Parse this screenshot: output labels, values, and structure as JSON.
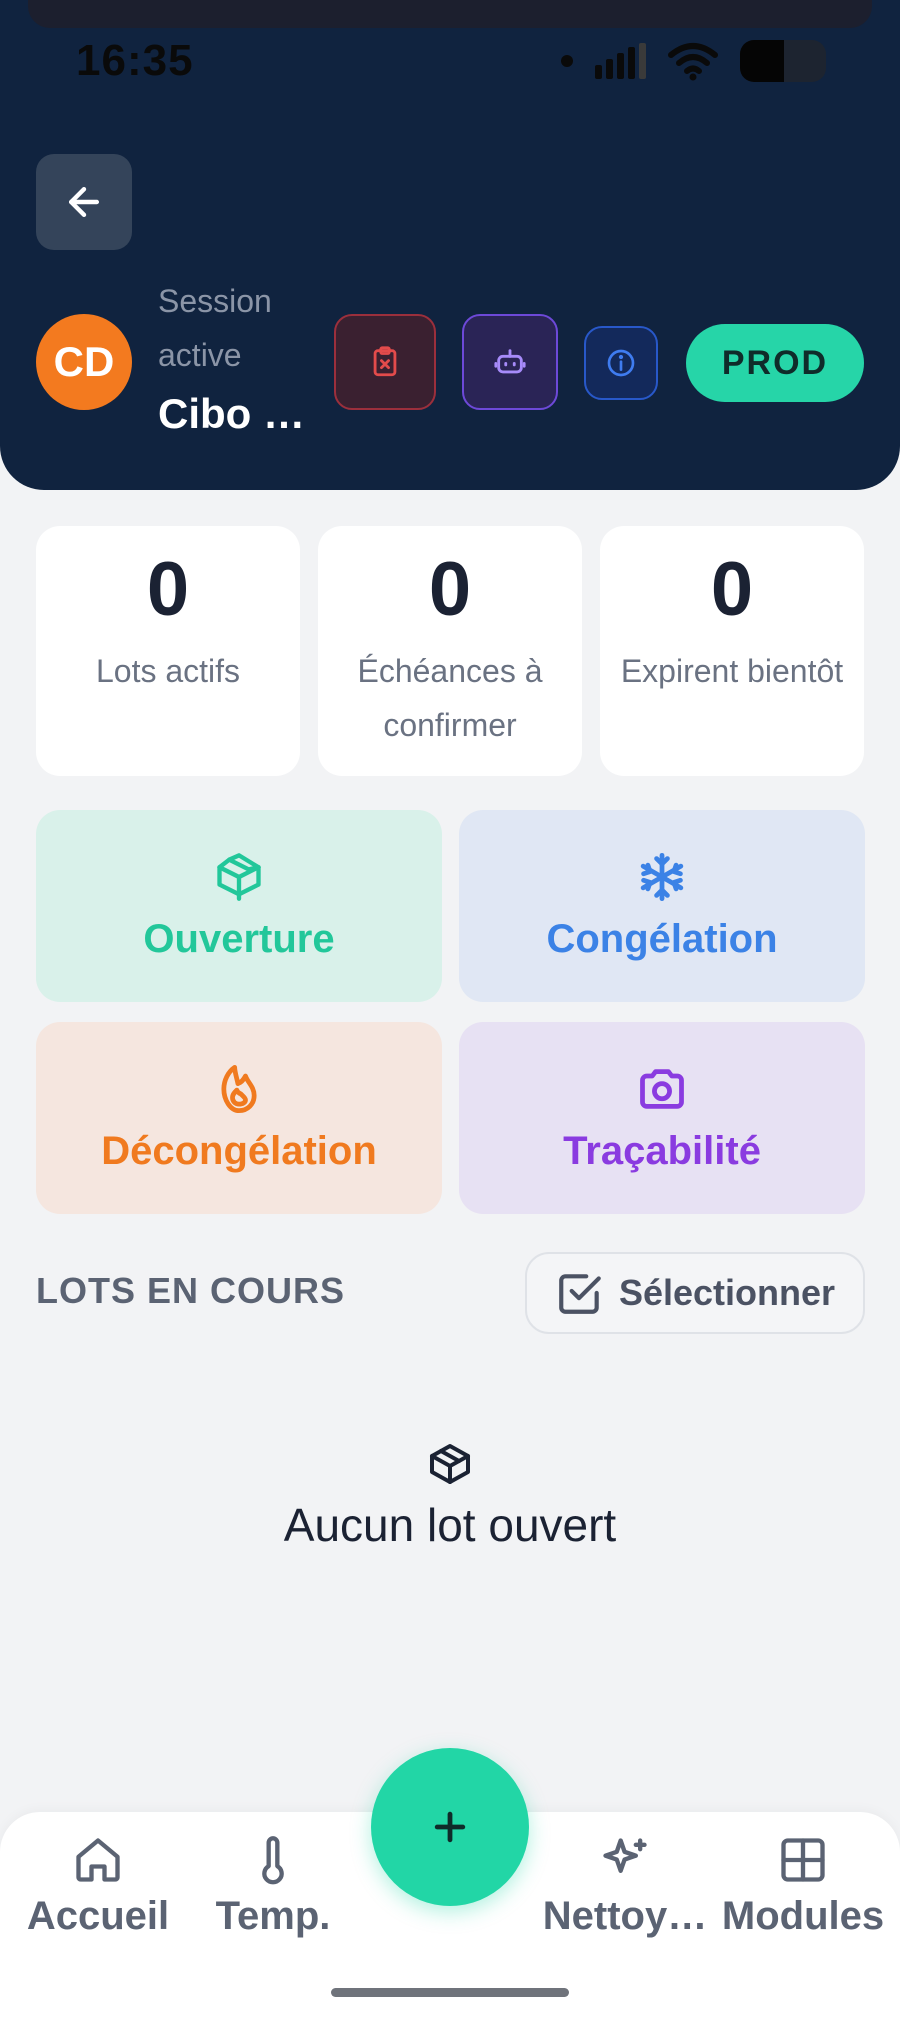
{
  "status_bar": {
    "time": "16:35"
  },
  "header": {
    "avatar_initials": "CD",
    "session_label": "Session active",
    "session_name": "Cibo …",
    "env_badge": "PROD"
  },
  "stats": [
    {
      "value": "0",
      "label": "Lots actifs"
    },
    {
      "value": "0",
      "label": "Échéances à confirmer"
    },
    {
      "value": "0",
      "label": "Expirent bientôt"
    }
  ],
  "actions": [
    {
      "label": "Ouverture",
      "icon": "package-open-icon",
      "color": "#22c79a",
      "bg": "#d9f1ea"
    },
    {
      "label": "Congélation",
      "icon": "snowflake-icon",
      "color": "#3b82e6",
      "bg": "#e0e7f4"
    },
    {
      "label": "Décongélation",
      "icon": "flame-icon",
      "color": "#f07a1f",
      "bg": "#f5e6df"
    },
    {
      "label": "Traçabilité",
      "icon": "camera-icon",
      "color": "#8a3be0",
      "bg": "#e7e1f3"
    }
  ],
  "lots": {
    "title": "LOTS EN COURS",
    "select_label": "Sélectionner",
    "empty_text": "Aucun lot ouvert"
  },
  "nav": {
    "items": [
      {
        "label": "Accueil",
        "icon": "home-icon"
      },
      {
        "label": "Temp.",
        "icon": "thermometer-icon"
      },
      {
        "label": "Nettoy…",
        "icon": "sparkles-icon"
      },
      {
        "label": "Modules",
        "icon": "grid-icon"
      }
    ],
    "fab_icon": "plus-icon"
  }
}
